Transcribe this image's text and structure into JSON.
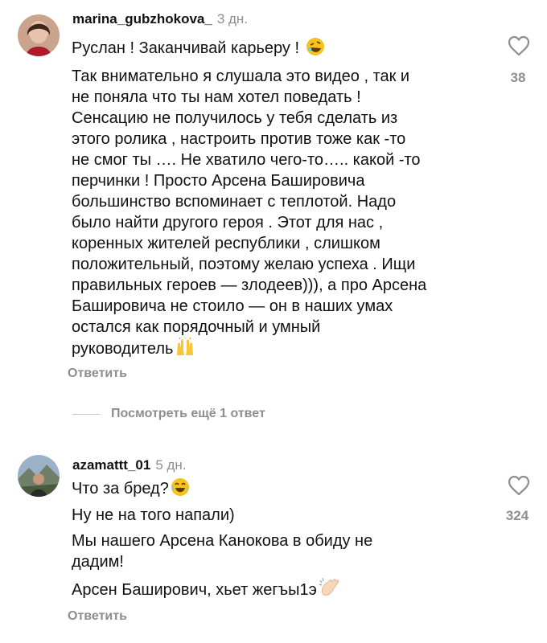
{
  "comments": [
    {
      "username": "marina_gubzhokova_",
      "time": "3 дн.",
      "lines": [
        "Руслан ! Заканчивай карьеру !",
        "Так внимательно я слушала это видео , так и",
        "не поняла что ты нам хотел поведать !",
        "Сенсацию не получилось у тебя сделать из",
        "этого ролика , настроить против тоже как -то",
        "не смог ты …. Не хватило чего-то….. какой -то",
        "перчинки ! Просто Арсена Башировича",
        "большинство вспоминает с теплотой.  Надо",
        "было найти другого героя . Этот для нас ,",
        "коренных жителей республики , слишком",
        "положительный, поэтому желаю успеха . Ищи",
        "правильных героев — злодеев))), а про Арсена",
        "Башировича  не стоило — он в наших умах",
        "остался как порядочный и умный",
        "руководитель"
      ],
      "emojis": [
        "rofl-emoji",
        "raised-hands-emoji"
      ],
      "likes": "38",
      "reply_label": "Ответить",
      "view_replies_label": "Посмотреть ещё 1 ответ"
    },
    {
      "username": "azamattt_01",
      "time": "5 дн.",
      "lines": [
        "Что за бред?",
        "Ну не на того напали)",
        "Мы нашего Арсена Канокова в обиду не",
        "дадим!",
        "Арсен Баширович, хьет жегъы1э"
      ],
      "emojis": [
        "joy-emoji",
        "clapping-hands-emoji"
      ],
      "likes": "324",
      "reply_label": "Ответить"
    }
  ],
  "icons": {
    "like": "heart-outline-icon"
  },
  "colors": {
    "text": "#111111",
    "muted": "#8e8e8e"
  }
}
